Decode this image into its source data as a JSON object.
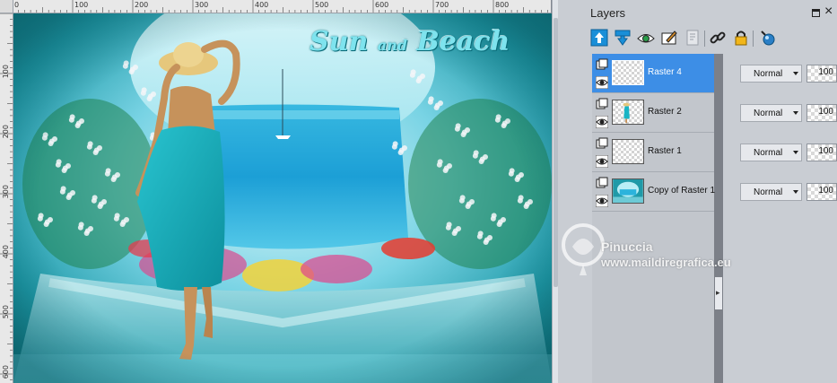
{
  "canvas": {
    "ruler_top_labels": [
      "0",
      "100",
      "200",
      "300",
      "400",
      "500",
      "600",
      "700",
      "800"
    ],
    "ruler_left_labels": [
      "100",
      "200",
      "300",
      "400",
      "500",
      "600"
    ],
    "artwork": {
      "title_main_1": "Sun",
      "title_small": "and",
      "title_main_2": "Beach"
    }
  },
  "layers_panel": {
    "title": "Layers",
    "toolbar": [
      {
        "name": "new-raster-layer-icon"
      },
      {
        "name": "new-layer-down-icon"
      },
      {
        "name": "layer-visibility-icon"
      },
      {
        "name": "mask-layer-icon"
      },
      {
        "name": "layer-properties-icon"
      },
      {
        "name": "link-icon"
      },
      {
        "name": "lock-icon"
      },
      {
        "name": "adjustment-layer-icon"
      }
    ],
    "layers": [
      {
        "name": "Raster 4",
        "blend_mode": "Normal",
        "opacity": "100",
        "selected": true
      },
      {
        "name": "Raster 2",
        "blend_mode": "Normal",
        "opacity": "100",
        "selected": false
      },
      {
        "name": "Raster 1",
        "blend_mode": "Normal",
        "opacity": "100",
        "selected": false
      },
      {
        "name": "Copy of Raster 1",
        "blend_mode": "Normal",
        "opacity": "100",
        "selected": false
      }
    ]
  },
  "watermark": {
    "name": "Pinuccia",
    "url": "www.maildiregrafica.eu"
  },
  "colors": {
    "selection": "#3d8ee6",
    "panel_bg": "#c9cdd3",
    "toolbar_accent": "#1a8fd8"
  }
}
